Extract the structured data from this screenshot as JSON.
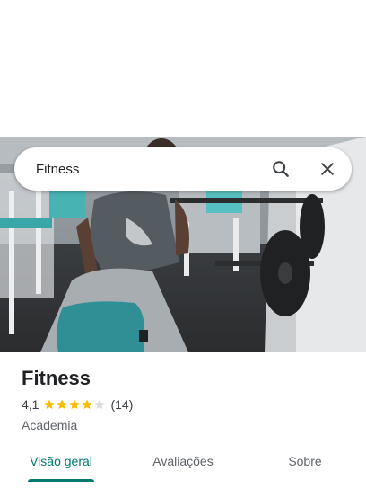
{
  "search": {
    "query": "Fitness",
    "search_icon": "search-icon",
    "close_icon": "close-icon"
  },
  "place": {
    "name": "Fitness",
    "rating": "4,1",
    "rating_value": 4.1,
    "stars_max": 5,
    "review_count": "(14)",
    "category": "Academia"
  },
  "tabs": [
    {
      "label": "Visão geral",
      "active": true
    },
    {
      "label": "Avaliações",
      "active": false
    },
    {
      "label": "Sobre",
      "active": false
    }
  ],
  "colors": {
    "accent": "#01796f",
    "star_filled": "#fbbc04",
    "star_empty": "#dadce0",
    "text_primary": "#202124",
    "text_secondary": "#5f6368"
  }
}
